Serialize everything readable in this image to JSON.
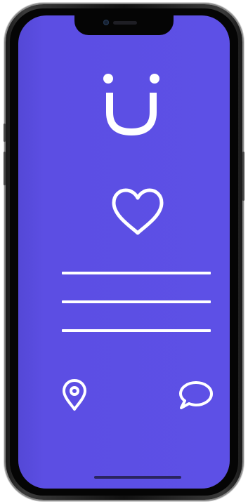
{
  "app": {
    "background_color": "#5d50e6",
    "foreground_color": "#ffffff"
  },
  "icons": {
    "logo": "smile-logo-icon",
    "heart": "heart-icon",
    "lines": "horizontal-lines",
    "location": "location-pin-icon",
    "chat": "chat-bubble-icon"
  }
}
